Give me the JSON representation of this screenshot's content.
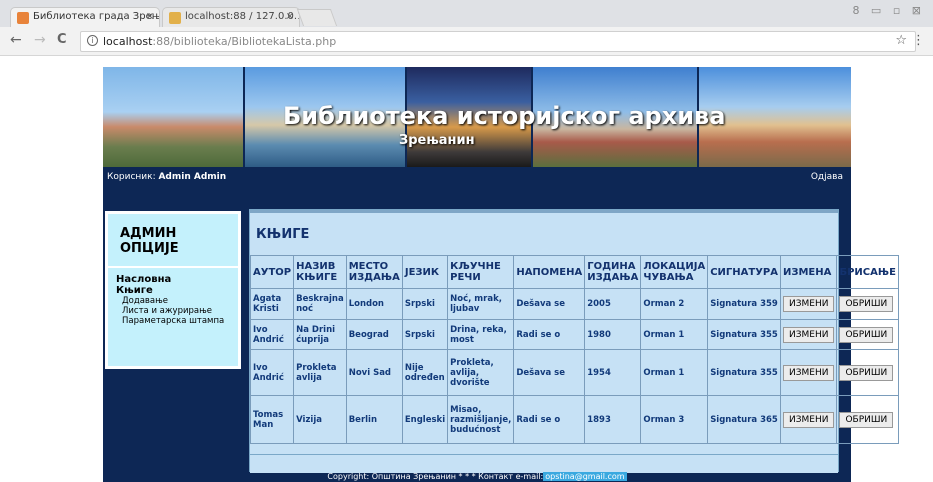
{
  "browser": {
    "tabs": [
      {
        "title": "Библиотека града Зрењ...",
        "close": "×",
        "favicon_color": "#e8833a"
      },
      {
        "title": "localhost:88 / 127.0.0.1 /...",
        "close": "×",
        "favicon_color": "#e2b04a"
      }
    ],
    "window_controls": "8 ▭ ▫ ⊠",
    "url_host": "localhost",
    "url_path": ":88/biblioteka/BibliotekaLista.php",
    "back": "←",
    "forward": "→",
    "reload": "C",
    "info": "i",
    "star": "☆",
    "menu": "⋮"
  },
  "site": {
    "title": "Библиотека историјског архива",
    "subtitle": "Зрењанин",
    "user_label": "Корисник: ",
    "user_name": "Admin Admin",
    "logout": "Одјава"
  },
  "sidebar": {
    "heading": "АДМИН ОПЦИЈЕ",
    "items": [
      {
        "label": "Насловна",
        "level": 1
      },
      {
        "label": "Књиге",
        "level": 1
      },
      {
        "label": "Додавање",
        "level": 2
      },
      {
        "label": "Листа и ажурирање",
        "level": 2
      },
      {
        "label": "Параметарска штампа",
        "level": 2
      }
    ]
  },
  "main": {
    "heading": "КЊИГЕ",
    "columns": [
      "АУТОР",
      "НАЗИВ КЊИГЕ",
      "МЕСТО ИЗДАЊА",
      "ЈЕЗИК",
      "КЉУЧНЕ РЕЧИ",
      "НАПОМЕНА",
      "ГОДИНА ИЗДАЊА",
      "ЛОКАЦИЈА ЧУВАЊА",
      "СИГНАТУРА",
      "ИЗМЕНА",
      "БРИСАЊЕ"
    ],
    "edit_label": "ИЗМЕНИ",
    "delete_label": "ОБРИШИ",
    "rows": [
      [
        "Agata Kristi",
        "Beskrajna noć",
        "London",
        "Srpski",
        "Noć, mrak, ljubav",
        "Dešava se",
        "2005",
        "Orman 2",
        "Signatura 359"
      ],
      [
        "Ivo Andrić",
        "Na Drini ćuprija",
        "Beograd",
        "Srpski",
        "Drina, reka, most",
        "Radi se o",
        "1980",
        "Orman 1",
        "Signatura 355"
      ],
      [
        "Ivo Andrić",
        "Prokleta avlija",
        "Novi Sad",
        "Nije određen",
        "Prokleta, avlija, dvorište",
        "Dešava se",
        "1954",
        "Orman 1",
        "Signatura 355"
      ],
      [
        "Tomas Man",
        "Vizija",
        "Berlin",
        "Engleski",
        "Misao, razmišljanje, budućnost",
        "Radi se o",
        "1893",
        "Orman 3",
        "Signatura 365"
      ]
    ]
  },
  "footer": {
    "copyright": "Copyright: Општина Зрењанин * * * Контакт e-mail:",
    "email": "opstina@gmail.com"
  }
}
